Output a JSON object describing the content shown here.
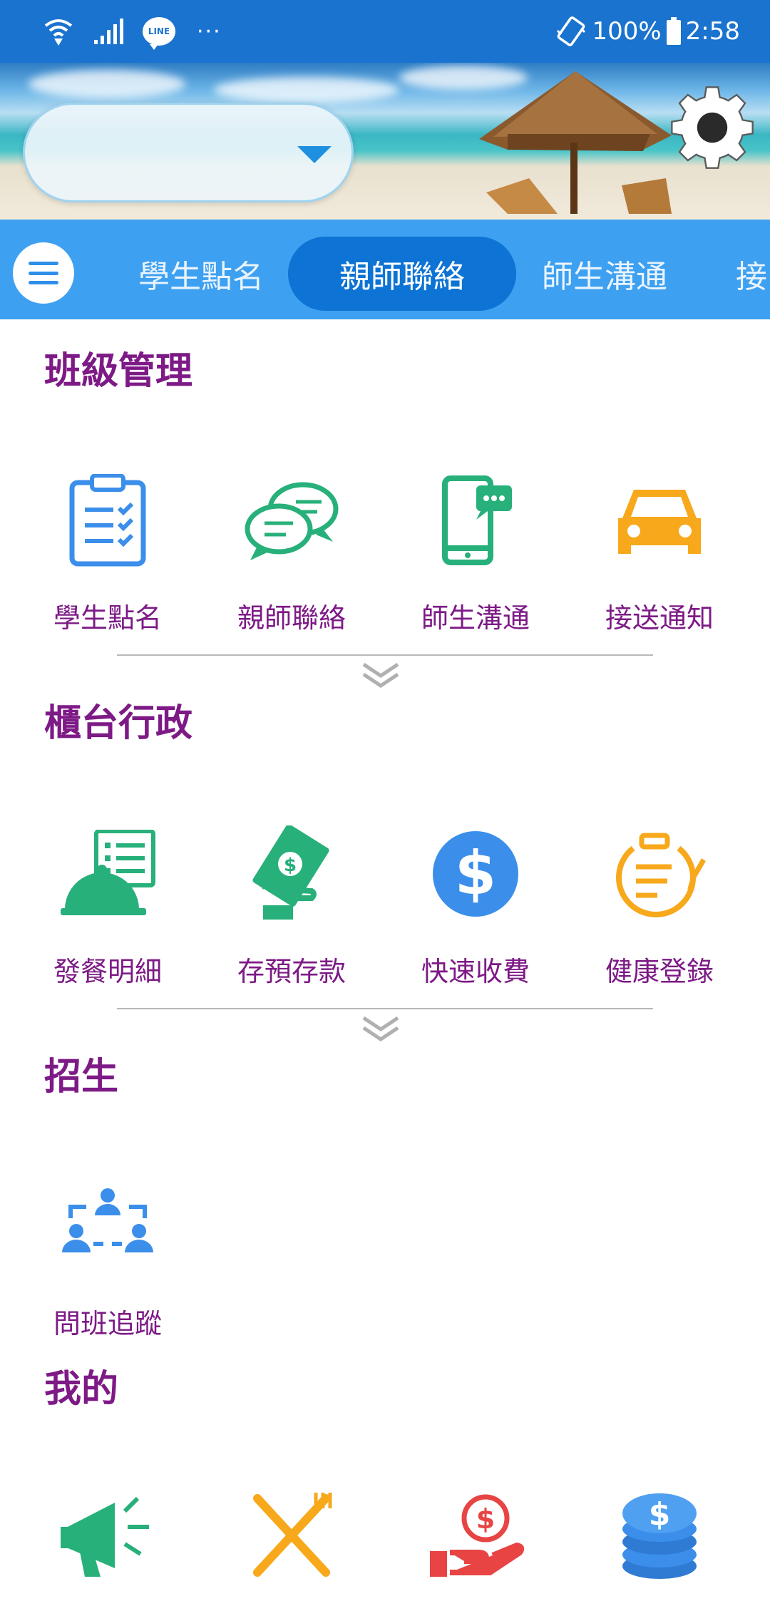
{
  "status_bar": {
    "line_label": "LINE",
    "dots": "···",
    "battery": "100%",
    "time": "2:58"
  },
  "header": {
    "select_value": ""
  },
  "tabs": [
    {
      "label": "學生點名",
      "active": false
    },
    {
      "label": "親師聯絡",
      "active": true
    },
    {
      "label": "師生溝通",
      "active": false
    },
    {
      "label": "接",
      "active": false
    }
  ],
  "sections": [
    {
      "title": "班級管理",
      "items": [
        {
          "label": "學生點名",
          "icon": "clipboard-check-icon",
          "color": "#3b8eea"
        },
        {
          "label": "親師聯絡",
          "icon": "chat-bubbles-icon",
          "color": "#27b07a"
        },
        {
          "label": "師生溝通",
          "icon": "phone-message-icon",
          "color": "#27b07a"
        },
        {
          "label": "接送通知",
          "icon": "car-icon",
          "color": "#f7a81b"
        }
      ]
    },
    {
      "title": "櫃台行政",
      "items": [
        {
          "label": "發餐明細",
          "icon": "meal-cloche-icon",
          "color": "#27b07a"
        },
        {
          "label": "存預存款",
          "icon": "cash-hand-icon",
          "color": "#27b07a"
        },
        {
          "label": "快速收費",
          "icon": "dollar-circle-icon",
          "color": "#3b8eea"
        },
        {
          "label": "健康登錄",
          "icon": "clipboard-pencil-icon",
          "color": "#f7a81b"
        }
      ]
    },
    {
      "title": "招生",
      "items": [
        {
          "label": "問班追蹤",
          "icon": "people-tracking-icon",
          "color": "#3b8eea"
        }
      ]
    },
    {
      "title": "我的",
      "items": [
        {
          "label": "",
          "icon": "megaphone-icon",
          "color": "#27b07a"
        },
        {
          "label": "",
          "icon": "fork-knife-icon",
          "color": "#f7a81b"
        },
        {
          "label": "",
          "icon": "money-hand-icon",
          "color": "#e84444"
        },
        {
          "label": "",
          "icon": "coin-stack-icon",
          "color": "#3b8eea"
        }
      ]
    }
  ]
}
